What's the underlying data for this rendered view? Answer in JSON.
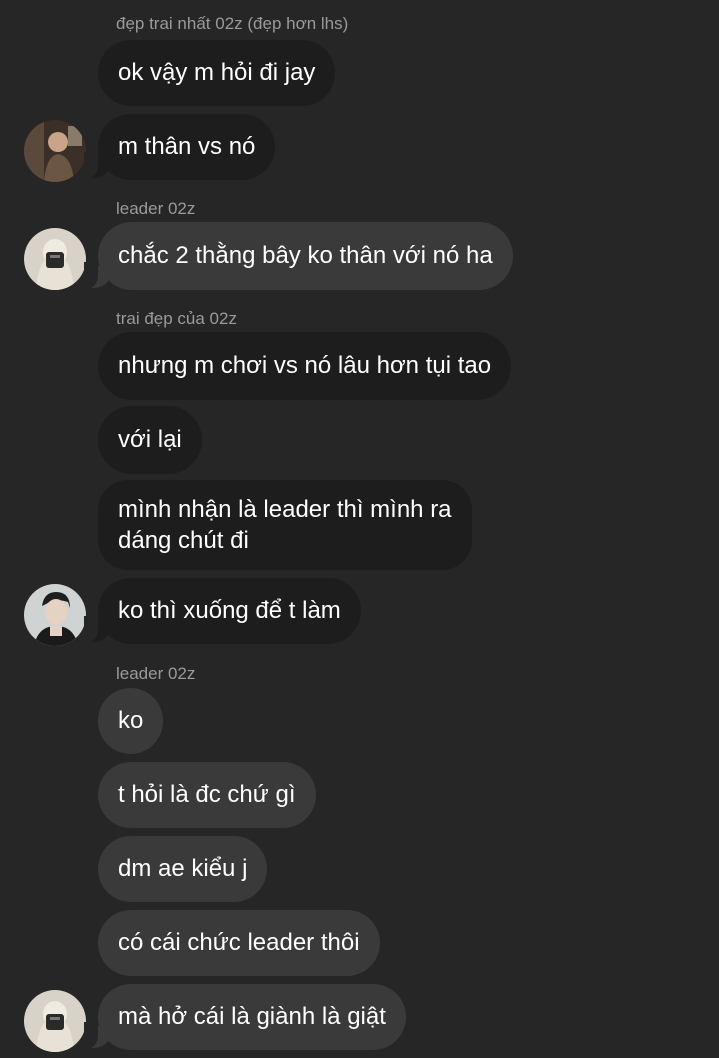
{
  "messages": [
    {
      "sender": "đẹp trai nhất 02z (đẹp hơn lhs)",
      "text": "ok vậy m hỏi đi jay"
    },
    {
      "text": "m thân vs nó"
    },
    {
      "sender": "leader 02z",
      "text": "chắc 2 thằng bây ko thân với nó ha"
    },
    {
      "sender": "trai đẹp của 02z",
      "text": "nhưng m chơi vs nó lâu hơn tụi tao"
    },
    {
      "text": "với lại"
    },
    {
      "text_line1": "mình nhận là leader thì mình ra",
      "text_line2": "dáng chút đi"
    },
    {
      "text": "ko thì xuống để t làm"
    },
    {
      "sender": "leader 02z",
      "text": "ko"
    },
    {
      "text": "t hỏi là đc chứ gì"
    },
    {
      "text": "dm ae kiểu j"
    },
    {
      "text": "có cái chức leader thôi"
    },
    {
      "text": "mà hở cái là giành là giật"
    }
  ],
  "colors": {
    "background": "#262626",
    "bubble_dark": "#1d1d1d",
    "bubble_light": "#3a3a3a",
    "sender_text": "#9a9a9a",
    "message_text": "#ffffff"
  }
}
